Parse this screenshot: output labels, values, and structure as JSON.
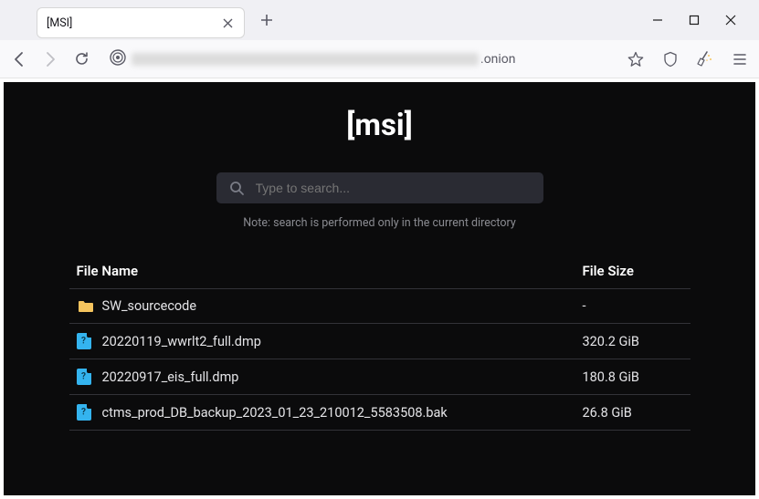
{
  "window": {
    "tab_title": "[MSI]"
  },
  "url": {
    "suffix": ".onion"
  },
  "page": {
    "title": "[msi]",
    "search_placeholder": "Type to search...",
    "search_note": "Note: search is performed only in the current directory"
  },
  "table": {
    "col_name": "File Name",
    "col_size": "File Size",
    "rows": [
      {
        "type": "folder",
        "name": "SW_sourcecode",
        "size": "-"
      },
      {
        "type": "file",
        "name": "20220119_wwrlt2_full.dmp",
        "size": "320.2 GiB"
      },
      {
        "type": "file",
        "name": "20220917_eis_full.dmp",
        "size": "180.8 GiB"
      },
      {
        "type": "file",
        "name": "ctms_prod_DB_backup_2023_01_23_210012_5583508.bak",
        "size": "26.8 GiB"
      }
    ]
  }
}
